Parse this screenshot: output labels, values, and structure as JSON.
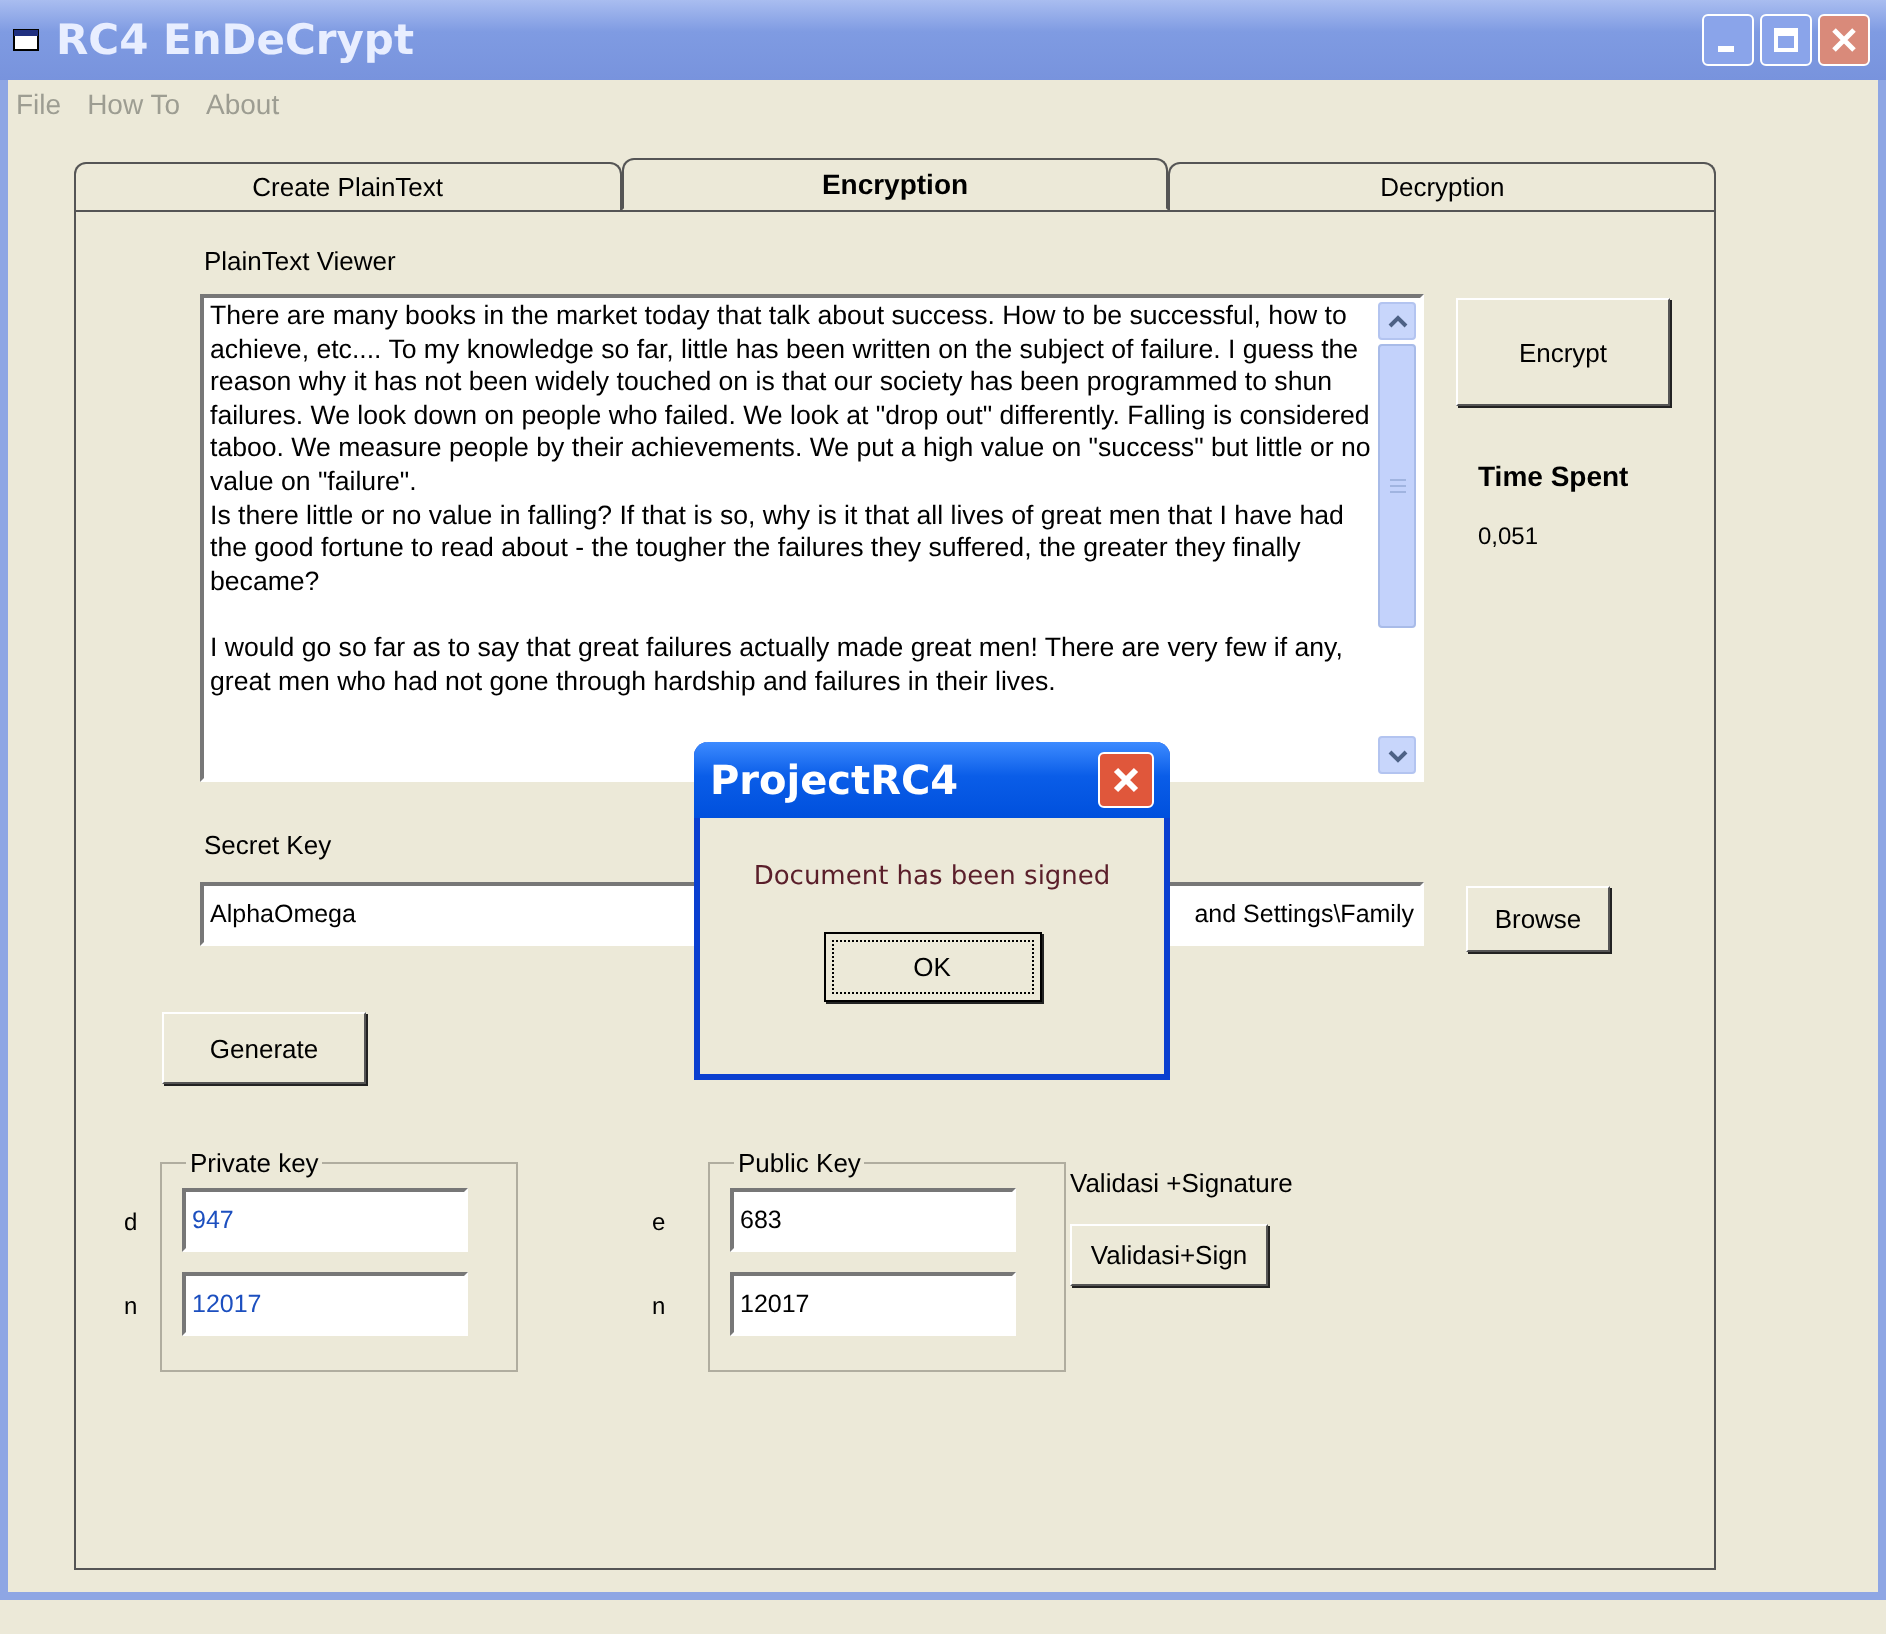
{
  "window": {
    "title": "RC4 EnDeCrypt",
    "active": false
  },
  "menu": [
    {
      "label": "File",
      "disabled": true
    },
    {
      "label": "How To",
      "disabled": true
    },
    {
      "label": "About",
      "disabled": true
    }
  ],
  "tabs": [
    {
      "label": "Create PlainText",
      "selected": false
    },
    {
      "label": "Encryption",
      "selected": true
    },
    {
      "label": "Decryption",
      "selected": false
    }
  ],
  "plaintext_viewer": {
    "label": "PlainText Viewer",
    "value": "There are many books in the market today that talk about success. How to be successful, how to achieve, etc.... To my knowledge so far, little has been written on the subject of failure. I guess the reason why it has not been widely touched on is that our society has been programmed to shun failures. We look down on people who failed. We look at \"drop out\" differently. Falling is considered taboo. We measure people by their achievements. We put a high value on \"success\" but little or no value on \"failure\".\nIs there little or no value in falling? If that is so, why is it that all lives of great men that I have had the good fortune to read about - the tougher the failures they suffered, the greater they finally became?\n\nI would go so far as to say that great failures actually made great men! There are very few if any, great men who had not gone through hardship and failures in their lives."
  },
  "encrypt_button": "Encrypt",
  "time_spent": {
    "label": "Time Spent",
    "value": "0,051"
  },
  "secret_key": {
    "label": "Secret Key",
    "value": "AlphaOmega"
  },
  "file_path": {
    "value": "and Settings\\Family"
  },
  "browse_button": "Browse",
  "generate_button": "Generate",
  "private_key": {
    "title": "Private key",
    "fields": [
      {
        "label": "d",
        "value": "947"
      },
      {
        "label": "n",
        "value": "12017"
      }
    ]
  },
  "public_key": {
    "title": "Public Key",
    "fields": [
      {
        "label": "e",
        "value": "683"
      },
      {
        "label": "n",
        "value": "12017"
      }
    ]
  },
  "validation": {
    "label": "Validasi +Signature",
    "button": "Validasi+Sign"
  },
  "dialog": {
    "title": "ProjectRC4",
    "message": "Document has been signed",
    "button": "OK"
  }
}
